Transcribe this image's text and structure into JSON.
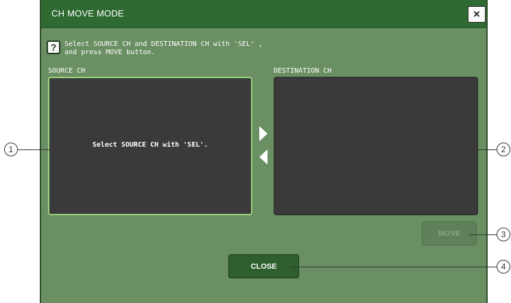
{
  "dialog": {
    "title": "CH MOVE MODE",
    "close_icon": "×",
    "help_icon": "?",
    "help_line1": "Select SOURCE CH and DESTINATION CH with 'SEL' ,",
    "help_line2": "and press MOVE button.",
    "source_label": "SOURCE CH",
    "destination_label": "DESTINATION CH",
    "source_message": "Select SOURCE CH with 'SEL'.",
    "move_label": "MOVE",
    "close_label": "CLOSE"
  },
  "callouts": [
    "1",
    "2",
    "3",
    "4"
  ]
}
